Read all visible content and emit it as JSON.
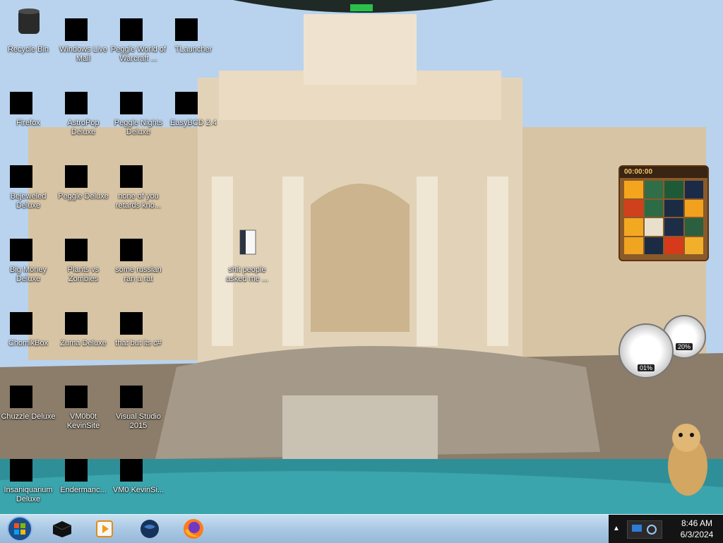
{
  "desktop": {
    "icons": [
      {
        "label": "Recycle Bin"
      },
      {
        "label": "Windows Live Mail"
      },
      {
        "label": "Peggle World of Warcraft ..."
      },
      {
        "label": "TLauncher"
      },
      {
        "label": "Firefox"
      },
      {
        "label": "AstroPop Deluxe"
      },
      {
        "label": "Peggle Nights Deluxe"
      },
      {
        "label": "EasyBCD 2.4"
      },
      {
        "label": "Bejeweled Deluxe"
      },
      {
        "label": "Peggle Deluxe"
      },
      {
        "label": "none of you retards kno..."
      },
      {
        "label": "Big Money Deluxe"
      },
      {
        "label": "Plants vs Zombies"
      },
      {
        "label": "some russian ran a rat"
      },
      {
        "label": "shit people asked me ..."
      },
      {
        "label": "ChomikBox"
      },
      {
        "label": "Zuma Deluxe"
      },
      {
        "label": "that but its c#"
      },
      {
        "label": "Chuzzle Deluxe"
      },
      {
        "label": "VM0b0t KevinSite"
      },
      {
        "label": "Visual Studio 2015"
      },
      {
        "label": "Insaniquarium Deluxe"
      },
      {
        "label": "Endermanc..."
      },
      {
        "label": "VM0 KevinSi..."
      }
    ]
  },
  "gadgets": {
    "puzzle": {
      "timer": "00:00:00"
    },
    "cpu_meter": {
      "cpu": "01%",
      "ram": "20%"
    }
  },
  "taskbar": {
    "start_icon": "windows-orb-icon",
    "pinned": [
      {
        "icon": "tlauncher-icon"
      },
      {
        "icon": "media-player-icon"
      },
      {
        "icon": "globe-icon"
      },
      {
        "icon": "firefox-icon"
      }
    ],
    "clock": {
      "time": "8:46 AM",
      "date": "6/3/2024"
    }
  }
}
